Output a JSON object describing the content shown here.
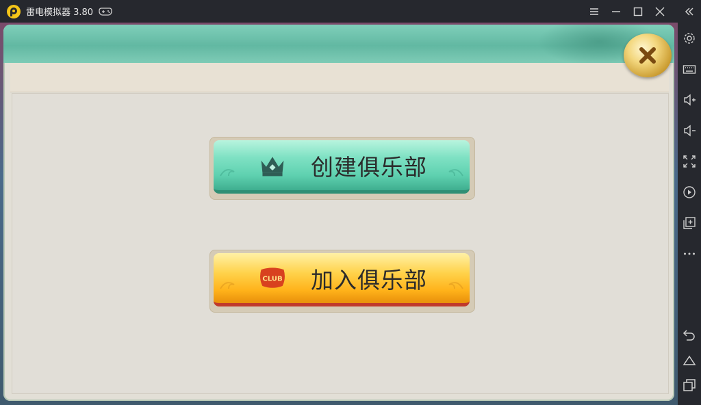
{
  "titlebar": {
    "app_title": "雷电模拟器 3.80",
    "icons": [
      "app-logo",
      "gamepad-icon",
      "menu-icon",
      "minimize-icon",
      "maximize-icon",
      "close-icon"
    ]
  },
  "sidebar": {
    "icons": [
      "collapse-icon",
      "settings-icon",
      "keyboard-icon",
      "volume-up-icon",
      "volume-down-icon",
      "fullscreen-icon",
      "record-icon",
      "multi-instance-icon",
      "more-icon",
      "back-icon",
      "home-icon",
      "recent-apps-icon"
    ]
  },
  "dialog": {
    "create_club_label": "创建俱乐部",
    "join_club_label": "加入俱乐部",
    "club_badge_text": "CLUB"
  },
  "colors": {
    "titlebar_bg": "#26282e",
    "create_button": "#6fdcbf",
    "join_button": "#ffc83a",
    "panel_bg": "#e1ded7",
    "banner": "#6fc3ad"
  }
}
